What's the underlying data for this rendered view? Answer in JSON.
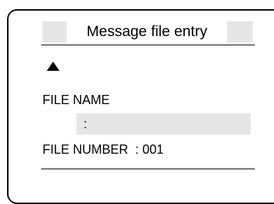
{
  "dialog": {
    "title": "Message file entry"
  },
  "icons": {
    "cursor_arrow": "up-triangle-icon"
  },
  "file_name": {
    "label": "FILE NAME",
    "separator": ":",
    "value": ""
  },
  "file_number": {
    "label": "FILE NUMBER",
    "separator": ":",
    "value": "001"
  }
}
